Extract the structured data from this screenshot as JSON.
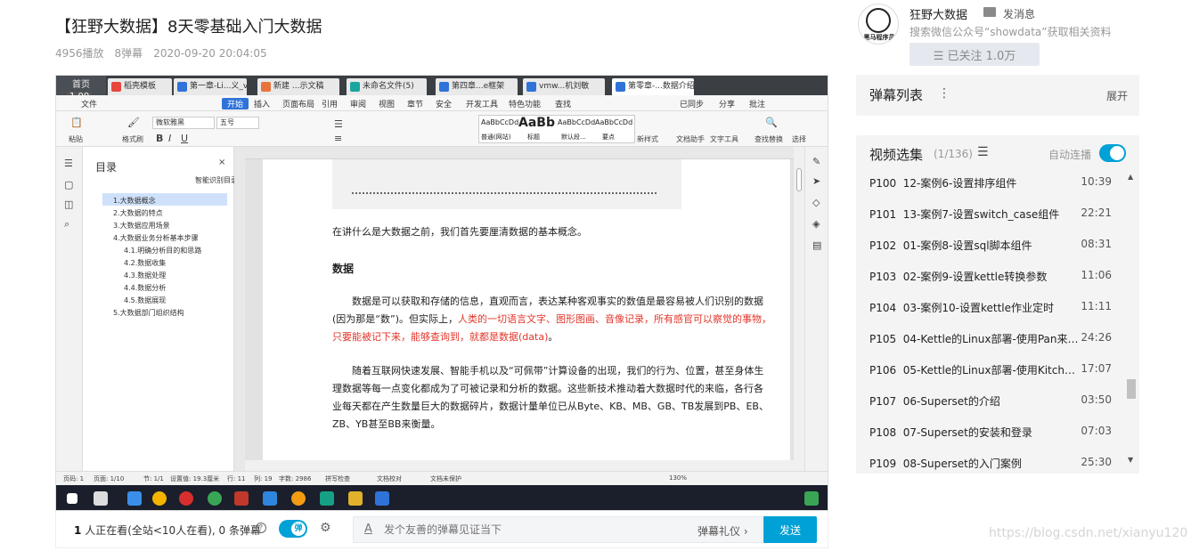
{
  "video": {
    "title": "【狂野大数据】8天零基础入门大数据",
    "plays": "4956播放",
    "danmaku_count": "8弹幕",
    "date": "2020-09-20 20:04:05"
  },
  "player_screen": {
    "home_tab": "首页",
    "speed_badge": "1.00",
    "tabs": [
      "稻壳模板",
      "第一章-Li...义_v1.0",
      "新建 ...示文稿",
      "未命名文件(5)",
      "第四章...e框架",
      "vmw...机刘敏",
      "第零章-...数据介绍"
    ],
    "ribbon": [
      "文件",
      "开始",
      "插入",
      "页面布局",
      "引用",
      "审阅",
      "视图",
      "章节",
      "安全",
      "开发工具",
      "特色功能",
      "查找",
      "已同步",
      "分享",
      "批注"
    ],
    "font_name": "微软雅黑",
    "font_size": "五号",
    "styles": [
      "AaBbCcDd",
      "AaBb",
      "AaBbCcDd",
      "AaBbCcDd"
    ],
    "style_labels": [
      "普通(网站)",
      "标题",
      "默认段...",
      "要点"
    ],
    "tool_labels": [
      "粘贴",
      "格式刷",
      "新样式",
      "文档助手",
      "文字工具",
      "查找替换",
      "选择"
    ],
    "toc_title": "目录",
    "toc_smart": "智能识别目录",
    "toc": [
      "1.大数据概念",
      "2.大数据的特点",
      "3.大数据应用场景",
      "4.大数据业务分析基本步骤",
      "4.1.明确分析目的和思路",
      "4.2.数据收集",
      "4.3.数据处理",
      "4.4.数据分析",
      "4.5.数据展现",
      "5.大数据部门组织结构"
    ],
    "doc": {
      "intro": "在讲什么是大数据之前，我们首先要厘清数据的基本概念。",
      "heading": "数据",
      "p1_a": "数据是可以获取和存储的信息，直观而言，表达某种客观事实的数值是最容易被人们识别的数据(因为那是“数”)。但实际上，",
      "p1_red": "人类的一切语言文字、图形图画、音像记录，所有感官可以察觉的事物，只要能被记下来，能够查询到，就都是数据(data)",
      "p1_end": "。",
      "p2": "随着互联网快速发展、智能手机以及“可佩带”计算设备的出现，我们的行为、位置，甚至身体生理数据等每一点变化都成为了可被记录和分析的数据。这些新技术推动着大数据时代的来临，各行各业每天都在产生数量巨大的数据碎片，数据计量单位已从Byte、KB、MB、GB、TB发展到PB、EB、ZB、YB甚至BB来衡量。"
    },
    "status": [
      "页码: 1",
      "页面: 1/10",
      "节: 1/1",
      "设置值: 19.3厘米",
      "行: 11",
      "列: 19",
      "字数: 2986",
      "拼写检查",
      "文档校对",
      "文档未保护",
      "130%"
    ]
  },
  "danmaku_bar": {
    "watching_count": "1",
    "watching_text": "人正在看(全站<10人在看), 0 条弹幕",
    "toggle_label": "弹",
    "input_placeholder": "发个友善的弹幕见证当下",
    "gift_label": "弹幕礼仪",
    "send_label": "发送"
  },
  "uploader": {
    "avatar_text": "黑马程序员",
    "name": "狂野大数据",
    "message_label": "发消息",
    "description": "搜索微信公众号“showdata”获取相关资料",
    "follow_label": "已关注 1.0万"
  },
  "danmaku_list": {
    "title": "弹幕列表",
    "expand_label": "展开"
  },
  "episodes": {
    "title": "视频选集",
    "count": "(1/136)",
    "autoplay_label": "自动连播",
    "autoplay_on": true,
    "items": [
      {
        "num": "P100",
        "name": "12-案例6-设置排序组件",
        "duration": "10:39"
      },
      {
        "num": "P101",
        "name": "13-案例7-设置switch_case组件",
        "duration": "22:21"
      },
      {
        "num": "P102",
        "name": "01-案例8-设置sql脚本组件",
        "duration": "08:31"
      },
      {
        "num": "P103",
        "name": "02-案例9-设置kettle转换参数",
        "duration": "11:06"
      },
      {
        "num": "P104",
        "name": "03-案例10-设置kettle作业定时",
        "duration": "11:11"
      },
      {
        "num": "P105",
        "name": "04-Kettle的Linux部署-使用Pan来执...",
        "duration": "24:26"
      },
      {
        "num": "P106",
        "name": "05-Kettle的Linux部署-使用Kitchen...",
        "duration": "17:07"
      },
      {
        "num": "P107",
        "name": "06-Superset的介绍",
        "duration": "03:50"
      },
      {
        "num": "P108",
        "name": "07-Superset的安装和登录",
        "duration": "07:03"
      },
      {
        "num": "P109",
        "name": "08-Superset的入门案例",
        "duration": "25:30"
      }
    ]
  },
  "watermark": "https://blog.csdn.net/xianyu120",
  "colors": {
    "accent": "#00a1d6",
    "doc_red": "#e2362b",
    "panel": "#f4f4f4"
  }
}
